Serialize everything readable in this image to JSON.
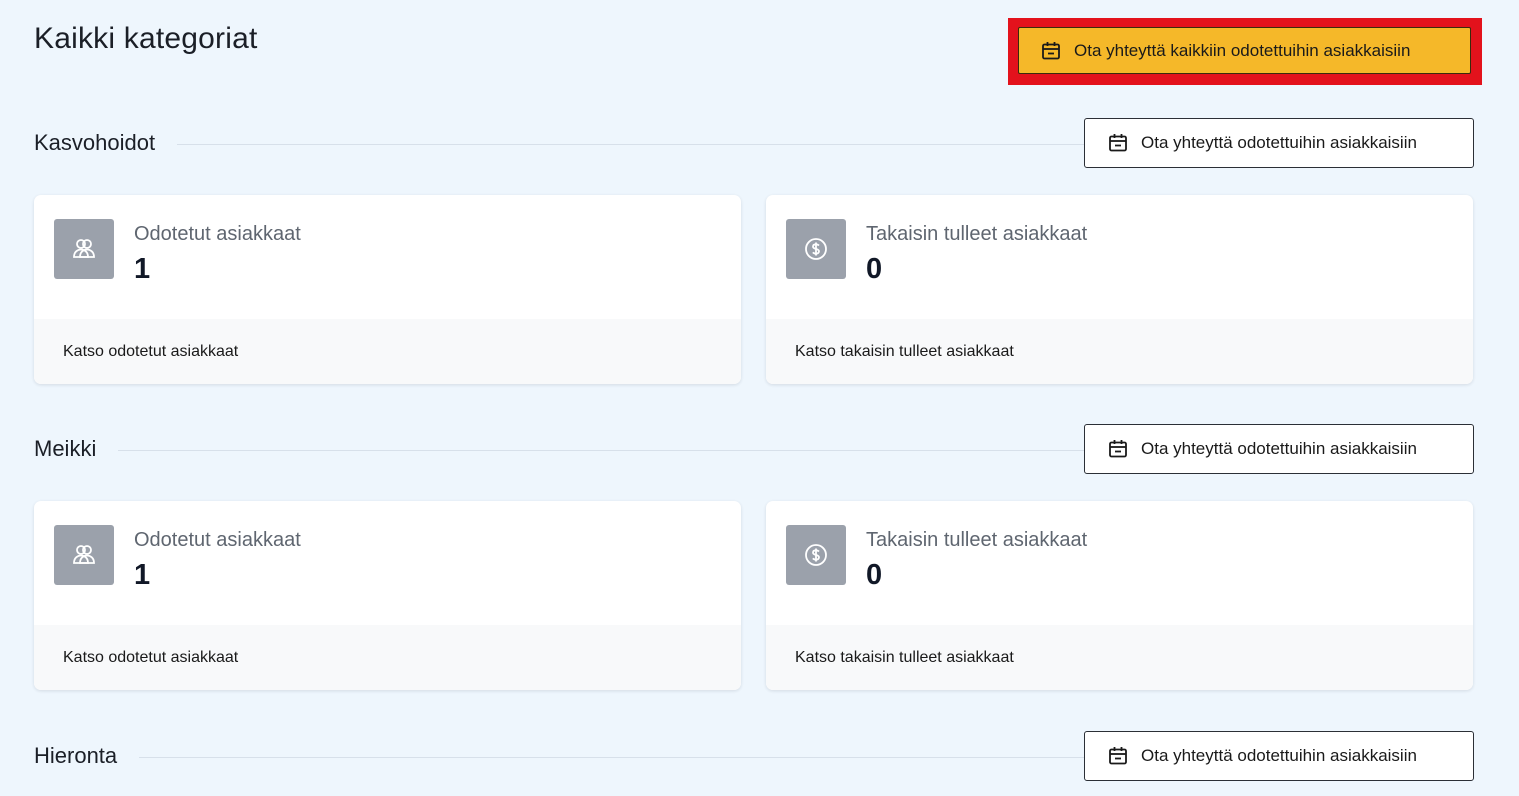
{
  "header": {
    "title": "Kaikki kategoriat",
    "contact_all_label": "Ota yhteyttä kaikkiin odotettuihin asiakkaisiin"
  },
  "sections": [
    {
      "title": "Kasvohoidot",
      "button_label": "Ota yhteyttä odotettuihin asiakkaisiin",
      "cards": [
        {
          "icon": "users-icon",
          "label": "Odotetut asiakkaat",
          "value": "1",
          "link": "Katso odotetut asiakkaat"
        },
        {
          "icon": "dollar-icon",
          "label": "Takaisin tulleet asiakkaat",
          "value": "0",
          "link": "Katso takaisin tulleet asiakkaat"
        }
      ]
    },
    {
      "title": "Meikki",
      "button_label": "Ota yhteyttä odotettuihin asiakkaisiin",
      "cards": [
        {
          "icon": "users-icon",
          "label": "Odotetut asiakkaat",
          "value": "1",
          "link": "Katso odotetut asiakkaat"
        },
        {
          "icon": "dollar-icon",
          "label": "Takaisin tulleet asiakkaat",
          "value": "0",
          "link": "Katso takaisin tulleet asiakkaat"
        }
      ]
    },
    {
      "title": "Hieronta",
      "button_label": "Ota yhteyttä odotettuihin asiakkaisiin"
    }
  ],
  "colors": {
    "background": "#eef6fd",
    "primary_button": "#f5b829",
    "highlight_border": "#e3121c",
    "icon_box": "#9ba1ab"
  }
}
